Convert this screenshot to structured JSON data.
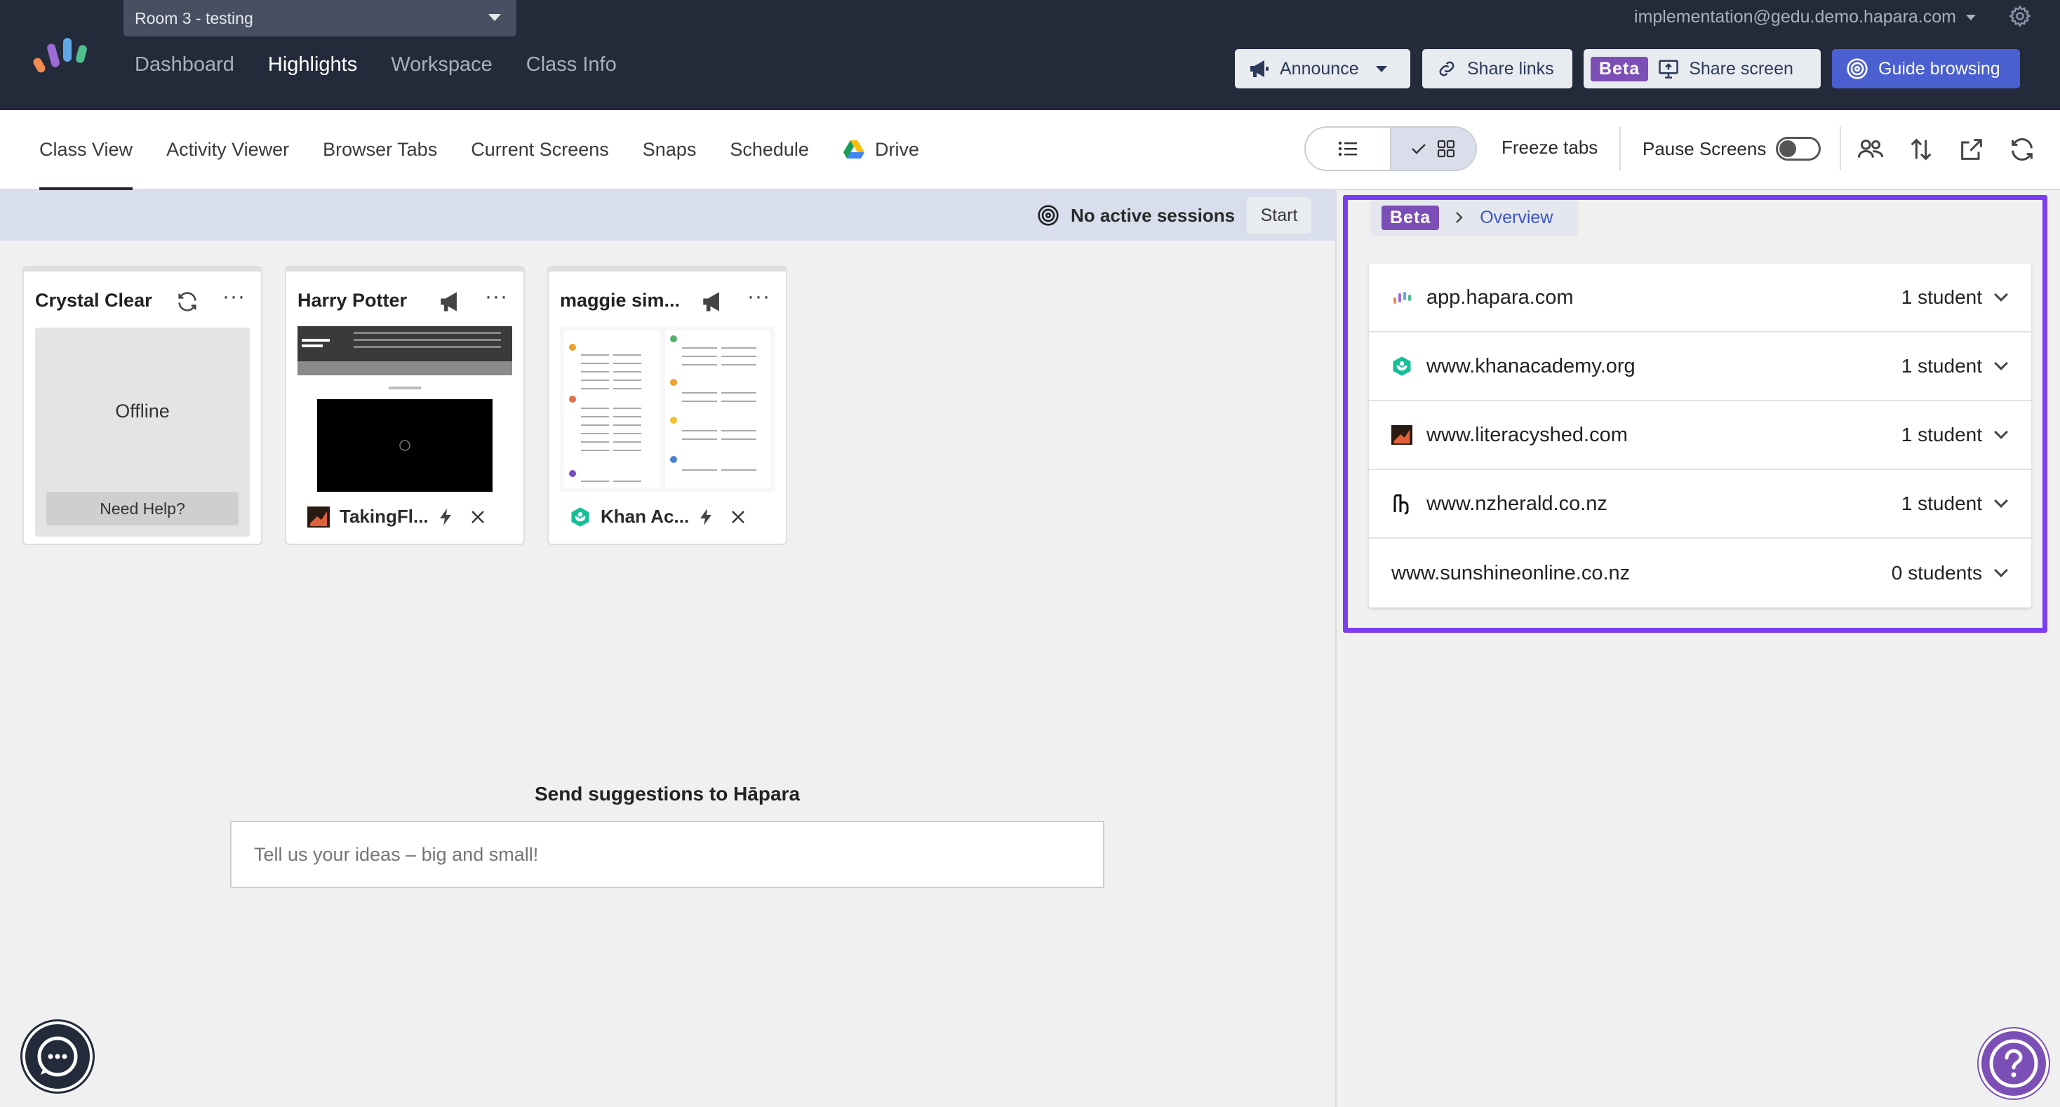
{
  "topbar": {
    "room_select": "Room 3 - testing",
    "nav": [
      "Dashboard",
      "Highlights",
      "Workspace",
      "Class Info"
    ],
    "active_nav": "Highlights",
    "account_email": "implementation@gedu.demo.hapara.com",
    "announce_label": "Announce",
    "share_links_label": "Share links",
    "beta_label": "Beta",
    "share_screen_label": "Share screen",
    "guide_browsing_label": "Guide browsing"
  },
  "subnav": {
    "tabs": [
      "Class View",
      "Activity Viewer",
      "Browser Tabs",
      "Current Screens",
      "Snaps",
      "Schedule",
      "Drive"
    ],
    "active_tab": "Class View",
    "freeze_tabs_label": "Freeze tabs",
    "pause_screens_label": "Pause Screens",
    "pause_screens_on": false
  },
  "sessions": {
    "status": "No active sessions",
    "start_label": "Start"
  },
  "students": [
    {
      "name": "Crystal Clear",
      "status": "Offline",
      "help_label": "Need Help?"
    },
    {
      "name": "Harry Potter",
      "tab_label": "TakingFl..."
    },
    {
      "name": "maggie sim...",
      "tab_label": "Khan Ac..."
    }
  ],
  "feedback": {
    "title": "Send suggestions to Hāpara",
    "placeholder": "Tell us your ideas – big and small!"
  },
  "overview": {
    "beta_label": "Beta",
    "crumb_label": "Overview",
    "sites": [
      {
        "domain": "app.hapara.com",
        "count": "1 student",
        "icon": "hapara-favicon"
      },
      {
        "domain": "www.khanacademy.org",
        "count": "1 student",
        "icon": "khanacademy-favicon"
      },
      {
        "domain": "www.literacyshed.com",
        "count": "1 student",
        "icon": "literacyshed-favicon"
      },
      {
        "domain": "www.nzherald.co.nz",
        "count": "1 student",
        "icon": "nzherald-favicon"
      },
      {
        "domain": "www.sunshineonline.co.nz",
        "count": "0 students",
        "icon": ""
      }
    ]
  },
  "colors": {
    "topbar_bg": "#232a3a",
    "accent_purple": "#7c4fb6",
    "guide_blue": "#4a5fd0",
    "highlight": "#7a3df2"
  }
}
